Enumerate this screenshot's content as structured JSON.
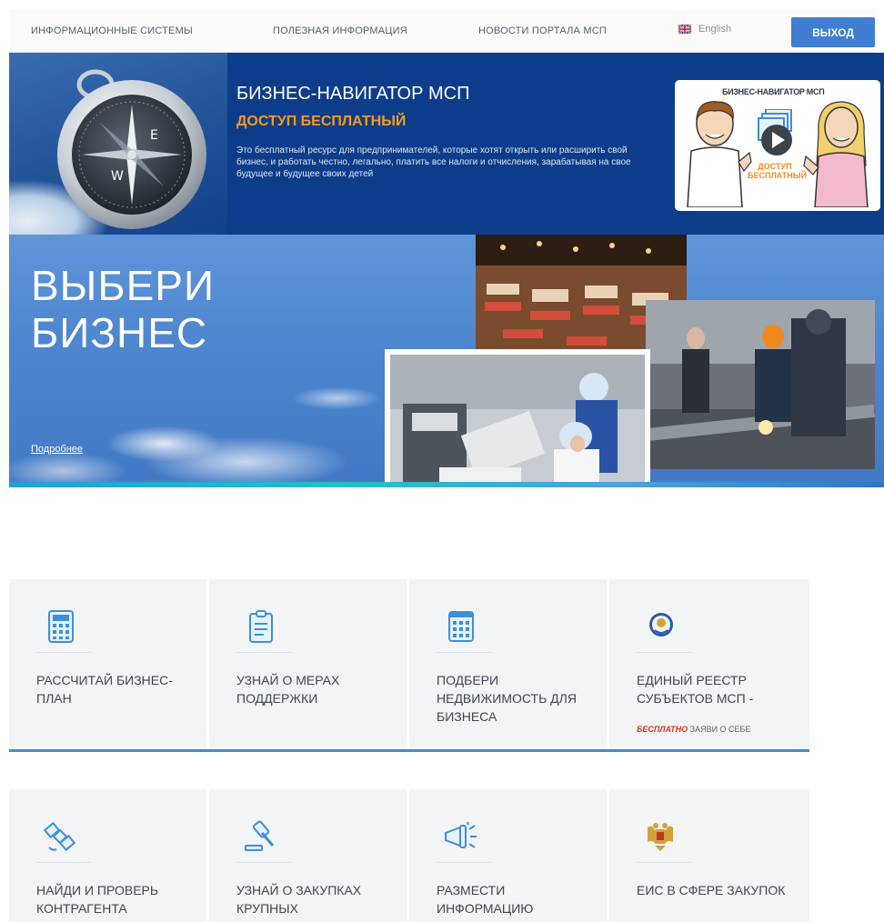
{
  "nav": {
    "items": [
      "ИНФОРМАЦИОННЫЕ СИСТЕМЫ",
      "ПОЛЕЗНАЯ ИНФОРМАЦИЯ",
      "НОВОСТИ ПОРТАЛА МСП"
    ],
    "language": "English",
    "logout": "ВЫХОД"
  },
  "navigator_banner": {
    "title": "БИЗНЕС-НАВИГАТОР МСП",
    "subtitle": "ДОСТУП БЕСПЛАТНЫЙ",
    "description": "Это бесплатный ресурс для предпринимателей, которые хотят открыть или расширить свой бизнес, и работать честно, легально, платить все налоги и отчисления, зарабатывая на свое будущее и будущее своих детей",
    "video_title": "БИЗНЕС-НАВИГАТОР МСП",
    "video_caption": "ДОСТУП БЕСПЛАТНЫЙ"
  },
  "business_banner": {
    "title_line1": "ВЫБЕРИ",
    "title_line2": "БИЗНЕС",
    "more_link": "Подробнее"
  },
  "cards_row1": [
    {
      "icon": "calculator-icon",
      "title": "РАССЧИТАЙ БИЗНЕС-ПЛАН"
    },
    {
      "icon": "clipboard-icon",
      "title": "УЗНАЙ О МЕРАХ ПОДДЕРЖКИ"
    },
    {
      "icon": "building-icon",
      "title": "ПОДБЕРИ НЕДВИЖИМОСТЬ ДЛЯ БИЗНЕСА"
    },
    {
      "icon": "tax-emblem-icon",
      "title": "ЕДИНЫЙ РЕЕСТР СУБЪЕКТОВ МСП -",
      "note_highlight": "БЕСПЛАТНО",
      "note_rest": "ЗАЯВИ О СЕБЕ"
    }
  ],
  "cards_row2": [
    {
      "icon": "satellite-icon",
      "title": "НАЙДИ И ПРОВЕРЬ КОНТРАГЕНТА"
    },
    {
      "icon": "gavel-icon",
      "title": "УЗНАЙ О ЗАКУПКАХ КРУПНЫХ"
    },
    {
      "icon": "megaphone-icon",
      "title": "РАЗМЕСТИ ИНФОРМАЦИЮ"
    },
    {
      "icon": "coat-of-arms-icon",
      "title": "ЕИС В СФЕРЕ ЗАКУПОК"
    }
  ],
  "colors": {
    "accent_blue": "#3f7ed0",
    "navigator_bg": "#0d3d8a",
    "orange": "#f59b1f",
    "highlight_red": "#e0331a"
  }
}
